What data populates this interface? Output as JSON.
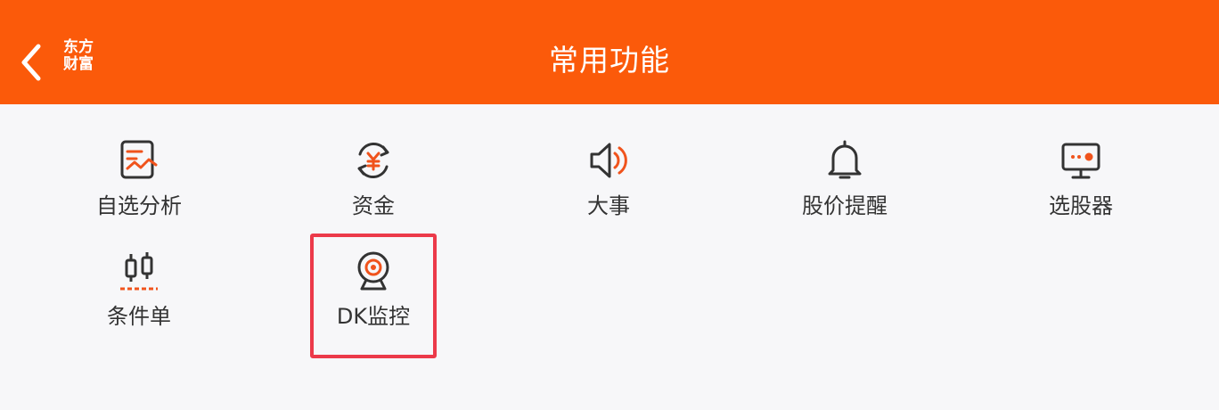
{
  "header": {
    "title": "常用功能",
    "brand_line1": "东方",
    "brand_line2": "财富"
  },
  "grid": {
    "items": [
      {
        "label": "自选分析",
        "icon": "chart-analysis-icon"
      },
      {
        "label": "资金",
        "icon": "yuan-cycle-icon"
      },
      {
        "label": "大事",
        "icon": "speaker-icon"
      },
      {
        "label": "股价提醒",
        "icon": "bell-icon"
      },
      {
        "label": "选股器",
        "icon": "monitor-icon"
      },
      {
        "label": "条件单",
        "icon": "candlestick-icon"
      },
      {
        "label": "DK监控",
        "icon": "webcam-icon"
      }
    ]
  },
  "colors": {
    "header_bg": "#fb5a0a",
    "accent": "#f0531c",
    "highlight_border": "#ec3a4a"
  }
}
